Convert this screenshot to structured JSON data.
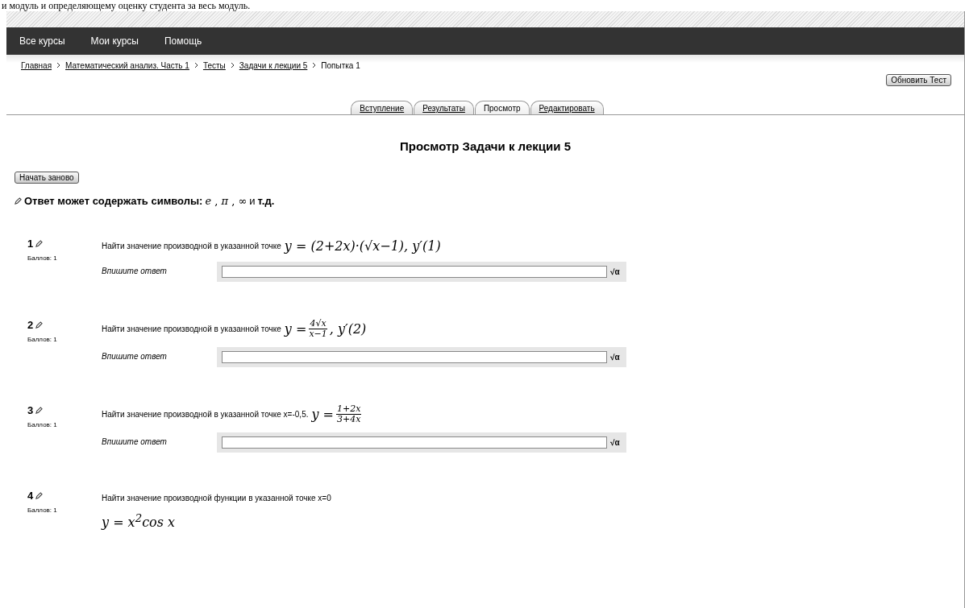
{
  "document_text": "и модуль и определяющему оценку студента за весь модуль.",
  "nav": [
    {
      "label": "Все курсы"
    },
    {
      "label": "Мои курсы"
    },
    {
      "label": "Помощь"
    }
  ],
  "breadcrumbs": [
    {
      "label": "Главная",
      "link": true
    },
    {
      "label": "Математический анализ. Часть 1",
      "link": true
    },
    {
      "label": "Тесты",
      "link": true
    },
    {
      "label": "Задачи к лекции 5",
      "link": true
    },
    {
      "label": "Попытка 1",
      "link": false
    }
  ],
  "update_button": "Обновить Тест",
  "tabs": [
    {
      "label": "Вступление",
      "selected": false
    },
    {
      "label": "Результаты",
      "selected": false
    },
    {
      "label": "Просмотр",
      "selected": true
    },
    {
      "label": "Редактировать",
      "selected": false
    }
  ],
  "heading": "Просмотр Задачи к лекции 5",
  "restart_button": "Начать заново",
  "note": {
    "text": "Ответ может содержать символы:",
    "symbols": "*e* , *π* , ∞",
    "tail": "и",
    "tail_bold": "т.д."
  },
  "questions": [
    {
      "number": "1",
      "points": "Баллов: 1",
      "text": "Найти значение производной в указанной точке",
      "formula": {
        "kind": "inline",
        "text": "y = (2+2x)·(√x−1),   y′(1)"
      },
      "answer_label": "Впишите ответ",
      "math_button": "√α"
    },
    {
      "number": "2",
      "points": "Баллов: 1",
      "text": "Найти значение производной в указанной точке",
      "formula": {
        "kind": "fraction",
        "prefix": "y =",
        "numerator": "4√x",
        "denominator": "x−1",
        "suffix": ", y′(2)"
      },
      "answer_label": "Впишите ответ",
      "math_button": "√α"
    },
    {
      "number": "3",
      "points": "Баллов: 1",
      "text": "Найти значение производной в указанной точке x=-0,5.",
      "formula": {
        "kind": "fraction",
        "prefix": "y =",
        "numerator": "1+2x",
        "denominator": "3+4x"
      },
      "answer_label": "Впишите ответ",
      "math_button": "√α"
    },
    {
      "number": "4",
      "points": "Баллов: 1",
      "text": "Найти значение производной функции в указанной точке x=0",
      "formula": {
        "kind": "block",
        "text": "y = x$^{2}$cos x"
      }
    }
  ]
}
